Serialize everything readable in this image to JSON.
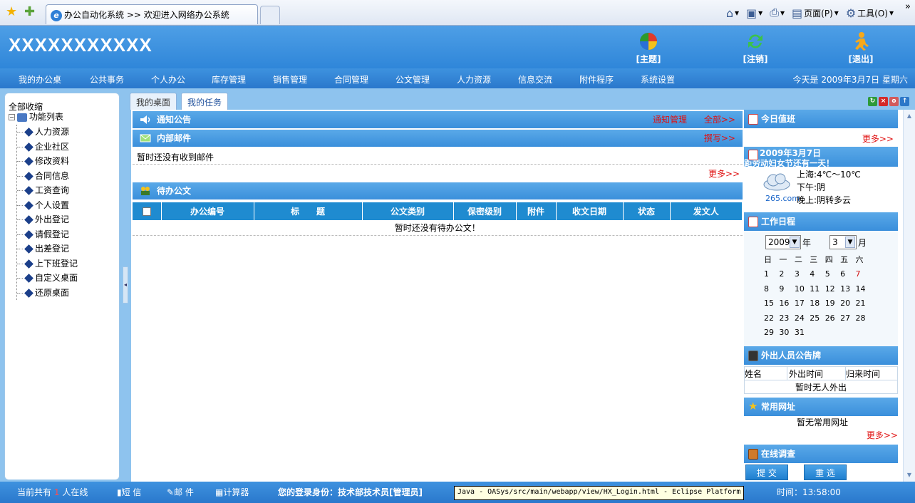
{
  "browser": {
    "tab_title": "办公自动化系统 >> 欢迎进入网络办公系统",
    "page_menu": "页面(P)",
    "tools_menu": "工具(O)"
  },
  "header": {
    "title": "XXXXXXXXXXX",
    "theme": "[主题]",
    "logout_switch": "[注销]",
    "exit": "[退出]"
  },
  "nav": {
    "items": [
      "我的办公桌",
      "公共事务",
      "个人办公",
      "库存管理",
      "销售管理",
      "合同管理",
      "公文管理",
      "人力资源",
      "信息交流",
      "附件程序",
      "系统设置"
    ],
    "today": "今天是 2009年3月7日 星期六"
  },
  "tree": {
    "collapse_all": "全部收缩",
    "root": "功能列表",
    "items": [
      "人力资源",
      "企业社区",
      "修改资料",
      "合同信息",
      "工资查询",
      "个人设置",
      "外出登记",
      "请假登记",
      "出差登记",
      "上下班登记",
      "自定义桌面",
      "还原桌面"
    ]
  },
  "tabs": {
    "desk": "我的桌面",
    "task": "我的任务"
  },
  "notice": {
    "title": "通知公告",
    "manage": "通知管理",
    "all": "全部>>"
  },
  "mail": {
    "title": "内部邮件",
    "compose": "撰写>>",
    "empty": "暂时还没有收到邮件",
    "more": "更多>>"
  },
  "docs": {
    "title": "待办公文",
    "columns": [
      "办公编号",
      "标　　题",
      "公文类别",
      "保密级别",
      "附件",
      "收文日期",
      "状态",
      "发文人"
    ],
    "empty": "暂时还没有待办公文！"
  },
  "duty": {
    "title": "今日值班",
    "more": "更多>>"
  },
  "today_box": {
    "date": "2009年3月7日",
    "festival": "距劳动妇女节还有一天！",
    "brand": "265.com",
    "city_temp": "上海:4℃～10℃",
    "afternoon": "下午:阴",
    "evening": "晚上:阴转多云"
  },
  "schedule": {
    "title": "工作日程",
    "year": "2009",
    "year_unit": "年",
    "month": "3",
    "month_unit": "月",
    "weekdays": [
      "日",
      "一",
      "二",
      "三",
      "四",
      "五",
      "六"
    ],
    "weeks": [
      [
        "1",
        "2",
        "3",
        "4",
        "5",
        "6",
        "7"
      ],
      [
        "8",
        "9",
        "10",
        "11",
        "12",
        "13",
        "14"
      ],
      [
        "15",
        "16",
        "17",
        "18",
        "19",
        "20",
        "21"
      ],
      [
        "22",
        "23",
        "24",
        "25",
        "26",
        "27",
        "28"
      ],
      [
        "29",
        "30",
        "31",
        "",
        "",
        "",
        ""
      ]
    ]
  },
  "outside": {
    "title": "外出人员公告牌",
    "columns": [
      "姓名",
      "外出时间",
      "归来时间"
    ],
    "empty": "暂时无人外出"
  },
  "links": {
    "title": "常用网址",
    "empty": "暂无常用网址",
    "more": "更多>>"
  },
  "survey": {
    "title": "在线调查",
    "submit": "提 交",
    "reset": "重 选"
  },
  "status": {
    "online_prefix": "当前共有",
    "online_count": "1",
    "online_suffix": "人在线",
    "sms": "短 信",
    "mail": "邮 件",
    "calc": "计算器",
    "identity": "您的登录身份：技术部技术员[管理员]",
    "time": "时间：13:58:00",
    "tooltip": "Java - OASys/src/main/webapp/view/HX_Login.html - Eclipse Platform"
  },
  "colors": {
    "header_blue": "#2f86d9",
    "workspace_blue": "#8ec3ee",
    "link_red": "#e01010"
  }
}
